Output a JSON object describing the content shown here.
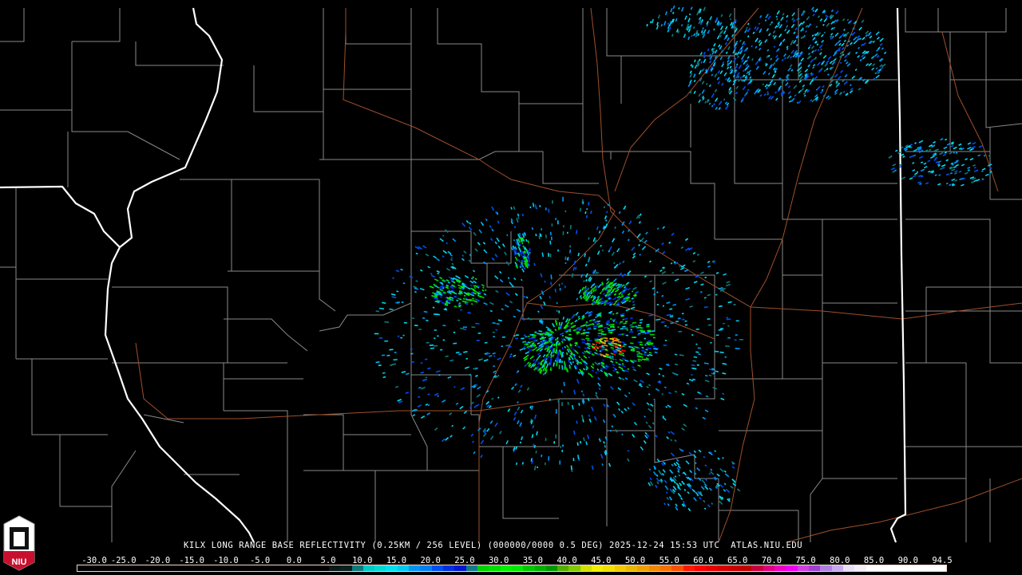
{
  "product": {
    "title": "KILX LONG RANGE BASE REFLECTIVITY (0.25KM / 256 LEVEL) (000000/0000 0.5 DEG) 2025-12-24 15:53 UTC  ATLAS.NIU.EDU"
  },
  "logo": {
    "text": "NIU",
    "color": "#c8102e"
  },
  "colorbar": {
    "labels": [
      "-30.0",
      "-25.0",
      "-20.0",
      "-15.0",
      "-10.0",
      "-5.0",
      "0.0",
      "5.0",
      "10.0",
      "15.0",
      "20.0",
      "25.0",
      "30.0",
      "35.0",
      "40.0",
      "45.0",
      "50.0",
      "55.0",
      "60.0",
      "65.0",
      "70.0",
      "75.0",
      "80.0",
      "85.0",
      "90.0",
      "94.5"
    ],
    "colors": [
      "#000000",
      "#000000",
      "#000000",
      "#000000",
      "#000000",
      "#000000",
      "#000000",
      "#000000",
      "#000000",
      "#000000",
      "#000000",
      "#000000",
      "#000000",
      "#000000",
      "#000000",
      "#000000",
      "#000000",
      "#000000",
      "#000000",
      "#000000",
      "#000000",
      "#000000",
      "#0a1a1a",
      "#0a2020",
      "#0f7a7a",
      "#00c8c8",
      "#00d8d8",
      "#00e0f0",
      "#00c8f0",
      "#0096f0",
      "#0080f0",
      "#0050f0",
      "#0030e0",
      "#0018d0",
      "#137a8a",
      "#00d000",
      "#00e000",
      "#00f000",
      "#00e800",
      "#00c800",
      "#00b000",
      "#009800",
      "#50b000",
      "#80c800",
      "#d0e000",
      "#f0f000",
      "#f0e000",
      "#f0c800",
      "#e8b800",
      "#f0a000",
      "#f08800",
      "#f87000",
      "#f85000",
      "#ff1800",
      "#ff0000",
      "#e80000",
      "#d80000",
      "#c80000",
      "#c00000",
      "#c80040",
      "#e00080",
      "#f000c0",
      "#f000f0",
      "#d040e0",
      "#a040d0",
      "#b080e0",
      "#c8a8f0",
      "#e8e0f8",
      "#f4eef8",
      "#ffffff",
      "#ffffff",
      "#ffffff",
      "#ffffff",
      "#ffffff",
      "#ffffff",
      "#ffffff"
    ]
  },
  "map_colors": {
    "state": "#ffffff",
    "county": "#8a8a8a",
    "road": "#a0502a"
  }
}
